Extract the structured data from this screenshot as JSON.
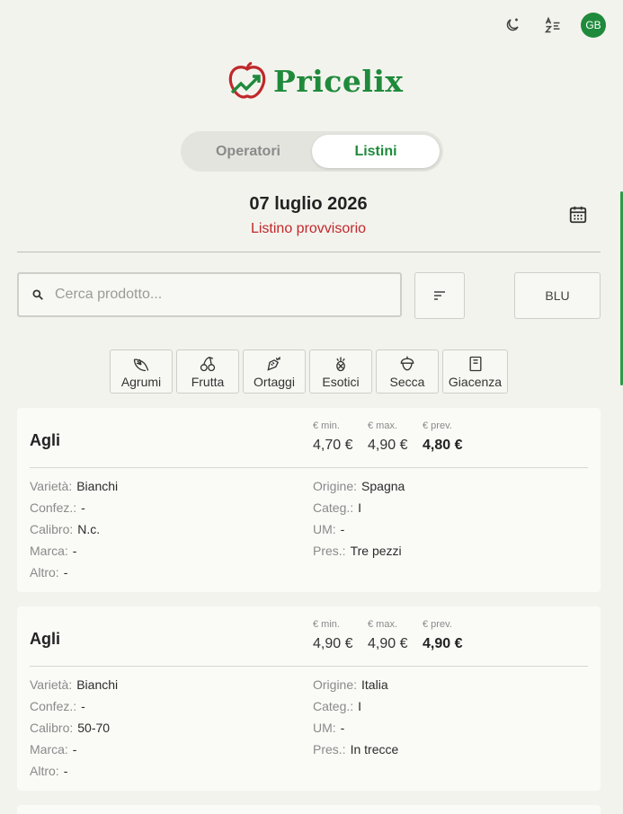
{
  "header": {
    "avatar_initials": "GB",
    "icons": [
      "theme-toggle-icon",
      "translate-icon"
    ]
  },
  "logo": {
    "text": "Pricelix",
    "color": "#1f8a3b"
  },
  "tabs": [
    {
      "label": "Operatori",
      "active": false
    },
    {
      "label": "Listini",
      "active": true
    }
  ],
  "listino": {
    "date": "07 luglio 2026",
    "status": "Listino provvisorio",
    "status_color": "#c0282a"
  },
  "search": {
    "placeholder": "Cerca prodotto...",
    "value": ""
  },
  "filter_button": {
    "label": "BLU"
  },
  "categories": [
    {
      "label": "Agrumi",
      "icon": "citrus-icon"
    },
    {
      "label": "Frutta",
      "icon": "cherry-icon"
    },
    {
      "label": "Ortaggi",
      "icon": "carrot-icon"
    },
    {
      "label": "Esotici",
      "icon": "pineapple-icon"
    },
    {
      "label": "Secca",
      "icon": "nut-icon"
    },
    {
      "label": "Giacenza",
      "icon": "stock-icon"
    }
  ],
  "price_labels": {
    "min": "€ min.",
    "max": "€ max.",
    "prev": "€ prev."
  },
  "detail_labels": {
    "varieta": "Varietà:",
    "confez": "Confez.:",
    "calibro": "Calibro:",
    "marca": "Marca:",
    "altro": "Altro:",
    "origine": "Origine:",
    "categ": "Categ.:",
    "um": "UM:",
    "pres": "Pres.:"
  },
  "products": [
    {
      "name": "Agli",
      "min": "4,70 €",
      "max": "4,90 €",
      "prev": "4,80 €",
      "varieta": "Bianchi",
      "confez": "-",
      "calibro": "N.c.",
      "marca": "-",
      "altro": "-",
      "origine": "Spagna",
      "categ": "I",
      "um": "-",
      "pres": "Tre pezzi"
    },
    {
      "name": "Agli",
      "min": "4,90 €",
      "max": "4,90 €",
      "prev": "4,90 €",
      "varieta": "Bianchi",
      "confez": "-",
      "calibro": "50-70",
      "marca": "-",
      "altro": "-",
      "origine": "Italia",
      "categ": "I",
      "um": "-",
      "pres": "In trecce"
    }
  ]
}
